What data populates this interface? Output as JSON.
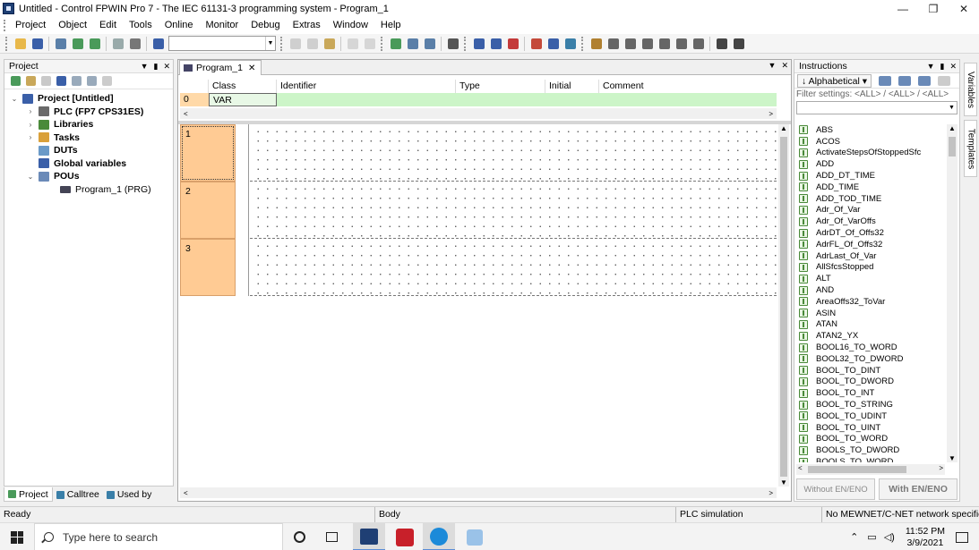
{
  "window": {
    "title": "Untitled - Control FPWIN Pro 7 - The IEC 61131-3 programming system - Program_1",
    "minimize": "—",
    "maximize": "❐",
    "close": "✕"
  },
  "menu": [
    "Project",
    "Object",
    "Edit",
    "Tools",
    "Online",
    "Monitor",
    "Debug",
    "Extras",
    "Window",
    "Help"
  ],
  "project_panel": {
    "title": "Project",
    "tree": [
      {
        "label": "Project [Untitled]",
        "level": 0,
        "bold": true,
        "icon": "project-icon",
        "expander": "⌄"
      },
      {
        "label": "PLC (FP7 CPS31ES)",
        "level": 1,
        "bold": true,
        "icon": "plc-icon",
        "expander": "›"
      },
      {
        "label": "Libraries",
        "level": 1,
        "bold": true,
        "icon": "libraries-icon",
        "expander": "›"
      },
      {
        "label": "Tasks",
        "level": 1,
        "bold": true,
        "icon": "tasks-icon",
        "expander": "›"
      },
      {
        "label": "DUTs",
        "level": 1,
        "bold": true,
        "icon": "duts-icon",
        "expander": ""
      },
      {
        "label": "Global variables",
        "level": 1,
        "bold": true,
        "icon": "global-variables-icon",
        "expander": ""
      },
      {
        "label": "POUs",
        "level": 1,
        "bold": true,
        "icon": "pous-icon",
        "expander": "⌄"
      },
      {
        "label": "Program_1 (PRG)",
        "level": 2,
        "bold": false,
        "icon": "program-icon",
        "expander": ""
      }
    ],
    "bottom_tabs": [
      "Project",
      "Calltree",
      "Used by"
    ]
  },
  "editor": {
    "tab_label": "Program_1",
    "declaration": {
      "columns": [
        "Class",
        "Identifier",
        "Type",
        "Initial",
        "Comment"
      ],
      "row": {
        "index": "0",
        "class": "VAR",
        "identifier": "",
        "type": "",
        "initial": "",
        "comment": ""
      }
    },
    "networks": [
      "1",
      "2",
      "3"
    ]
  },
  "instructions_panel": {
    "title": "Instructions",
    "sort_label": "Alphabetical",
    "filter": "Filter settings: <ALL> / <ALL> / <ALL>",
    "items": [
      "ABS",
      "ACOS",
      "ActivateStepsOfStoppedSfc",
      "ADD",
      "ADD_DT_TIME",
      "ADD_TIME",
      "ADD_TOD_TIME",
      "Adr_Of_Var",
      "Adr_Of_VarOffs",
      "AdrDT_Of_Offs32",
      "AdrFL_Of_Offs32",
      "AdrLast_Of_Var",
      "AllSfcsStopped",
      "ALT",
      "AND",
      "AreaOffs32_ToVar",
      "ASIN",
      "ATAN",
      "ATAN2_YX",
      "BOOL16_TO_WORD",
      "BOOL32_TO_DWORD",
      "BOOL_TO_DINT",
      "BOOL_TO_DWORD",
      "BOOL_TO_INT",
      "BOOL_TO_STRING",
      "BOOL_TO_UDINT",
      "BOOL_TO_UINT",
      "BOOL_TO_WORD",
      "BOOLS_TO_DWORD",
      "BOOLS_TO_WORD"
    ],
    "btn_without": "Without EN/ENO",
    "btn_with": "With EN/ENO"
  },
  "side_tabs": [
    "Variables",
    "Templates"
  ],
  "statusbar": {
    "ready": "Ready",
    "section": "Body",
    "mode": "PLC simulation",
    "network": "No MEWNET/C-NET network specified"
  },
  "taskbar": {
    "search_placeholder": "Type here to search",
    "time": "11:52 PM",
    "date": "3/9/2021"
  },
  "colors": {
    "network_header": "#ffcb94",
    "decl_row": "#ccf5c8",
    "accent": "#5a8dd6"
  }
}
